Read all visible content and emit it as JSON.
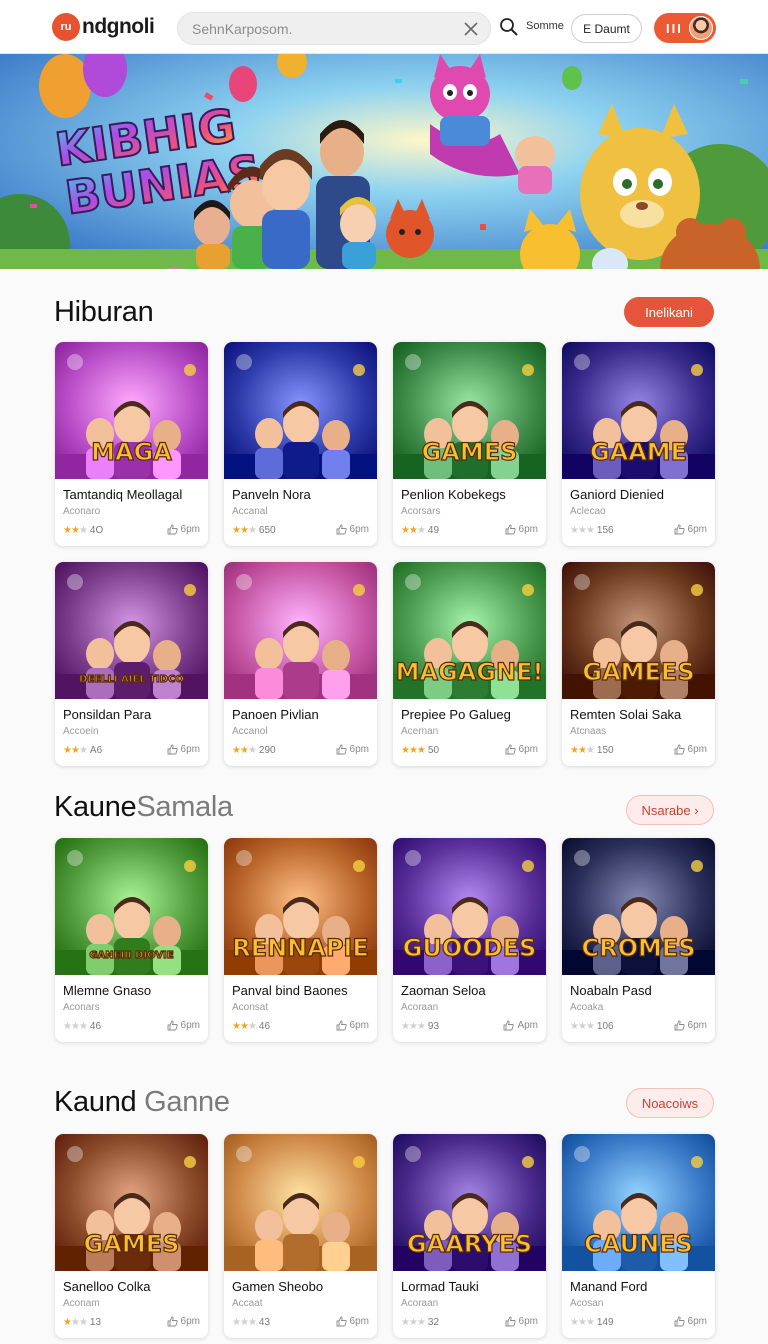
{
  "header": {
    "logo_mark": "ru",
    "logo_text": "ndgnoli",
    "search_placeholder": "SehnKarposom.",
    "some_link": "Somme",
    "outline_button": "E Daumt",
    "user_button_label": "III"
  },
  "hero": {
    "title_line1": "KIBHIG",
    "title_line2": "BUNIAS"
  },
  "sections": [
    {
      "title": "Hiburan",
      "title_light": "",
      "button": "Inelikani",
      "button_style": "solid",
      "cards": [
        {
          "title": "Tamtandiq Meollagal",
          "sub": "Aconaro",
          "rating": "4O",
          "stars": 2,
          "action": "6pm",
          "thumb_text": "MAGA",
          "theme": "#b94fc8"
        },
        {
          "title": "Panveln Nora",
          "sub": "Accanal",
          "rating": "650",
          "stars": 2,
          "action": "6pm",
          "thumb_text": "",
          "theme": "#2b3aa8"
        },
        {
          "title": "Penlion Kobekegs",
          "sub": "Acorsars",
          "rating": "49",
          "stars": 2,
          "action": "6pm",
          "thumb_text": "GAMES",
          "theme": "#3f8c4a"
        },
        {
          "title": "Ganiord Dienied",
          "sub": "Aclecao",
          "rating": "156",
          "stars": 0,
          "action": "6pm",
          "thumb_text": "GAAME",
          "theme": "#3a2a8c"
        }
      ]
    },
    {
      "title": "",
      "title_light": "",
      "button": "",
      "button_style": "",
      "cards": [
        {
          "title": "Ponsildan Para",
          "sub": "Accoein",
          "rating": "A6",
          "stars": 2,
          "action": "6pm",
          "thumb_text": "DEELLI AIEL TIDCO",
          "theme": "#7a3b8a"
        },
        {
          "title": "Panoen Pivlian",
          "sub": "Accanol",
          "rating": "290",
          "stars": 2,
          "action": "6pm",
          "thumb_text": "",
          "theme": "#c85aa8"
        },
        {
          "title": "Prepiee Po Galueg",
          "sub": "Acernan",
          "rating": "50",
          "stars": 3,
          "action": "6pm",
          "thumb_text": "MAGAGNE!",
          "theme": "#4a9a4f"
        },
        {
          "title": "Remten Solai Saka",
          "sub": "Atcnaas",
          "rating": "150",
          "stars": 2,
          "action": "6pm",
          "thumb_text": "GAMEES",
          "theme": "#6b3a1e"
        }
      ]
    },
    {
      "title": "Kaune",
      "title_light": "Samala",
      "button": "Nsarabe ›",
      "button_style": "soft",
      "cards": [
        {
          "title": "Mlemne Gnaso",
          "sub": "Aconars",
          "rating": "46",
          "stars": 0,
          "action": "6pm",
          "thumb_text": "GANEIII DIOVIE",
          "theme": "#4f9a3a"
        },
        {
          "title": "Panval bind Baones",
          "sub": "Aconsat",
          "rating": "46",
          "stars": 2,
          "action": "6pm",
          "thumb_text": "RENNAPIE",
          "theme": "#b8642a"
        },
        {
          "title": "Zaoman Seloa",
          "sub": "Acoraan",
          "rating": "93",
          "stars": 0,
          "action": "Apm",
          "thumb_text": "GUOODES",
          "theme": "#5a2f9a"
        },
        {
          "title": "Noabaln Pasd",
          "sub": "Acoaka",
          "rating": "106",
          "stars": 0,
          "action": "6pm",
          "thumb_text": "CROMES",
          "theme": "#2a2f5a"
        }
      ]
    },
    {
      "title": "Kaund",
      "title_light": "Ganne",
      "button": "Noacoiws",
      "button_style": "soft",
      "cards": [
        {
          "title": "Sanelloo Colka",
          "sub": "Aconam",
          "rating": "13",
          "stars": 1,
          "action": "6pm",
          "thumb_text": "GAMES",
          "theme": "#8a4a2a"
        },
        {
          "title": "Gamen Sheobo",
          "sub": "Accaat",
          "rating": "43",
          "stars": 0,
          "action": "6pm",
          "thumb_text": "",
          "theme": "#d08a4a"
        },
        {
          "title": "Lormad Tauki",
          "sub": "Acoraan",
          "rating": "32",
          "stars": 0,
          "action": "6pm",
          "thumb_text": "GAARYES",
          "theme": "#4a2a8a"
        },
        {
          "title": "Manand Ford",
          "sub": "Acosan",
          "rating": "149",
          "stars": 0,
          "action": "6pm",
          "thumb_text": "CAUNES",
          "theme": "#3a7ac8"
        }
      ]
    }
  ]
}
